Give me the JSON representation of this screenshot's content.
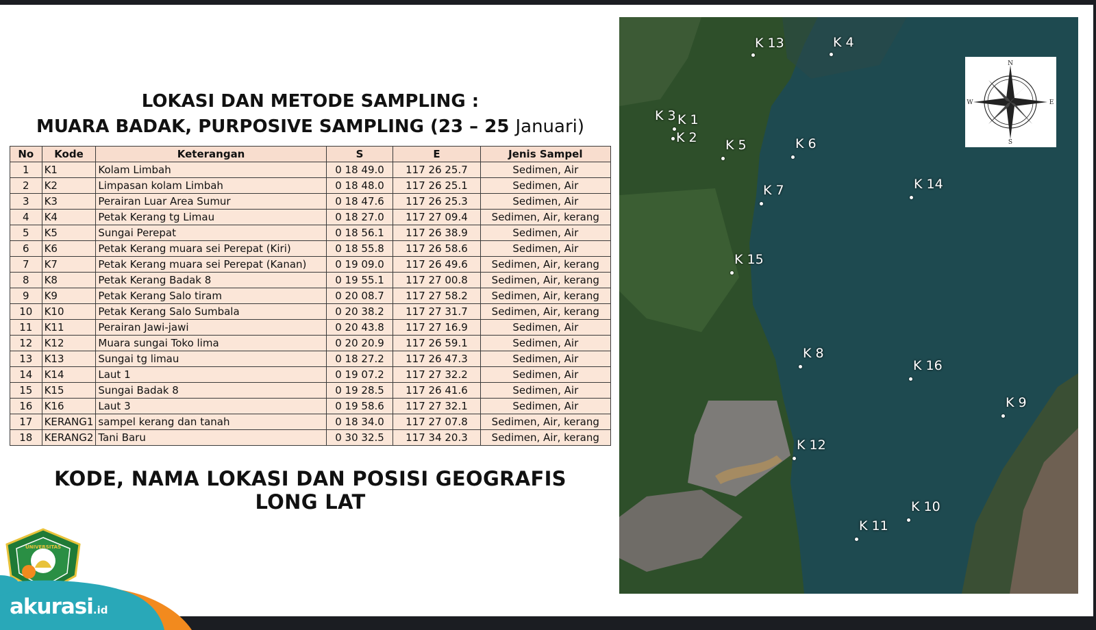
{
  "title": {
    "line1": "LOKASI DAN METODE SAMPLING :",
    "line2_bold": "MUARA BADAK, PURPOSIVE SAMPLING (23 – 25 ",
    "line2_light": "Januari)"
  },
  "table": {
    "headers": [
      "No",
      "Kode",
      "Keterangan",
      "S",
      "E",
      "Jenis Sampel"
    ],
    "rows": [
      [
        "1",
        "K1",
        "Kolam Limbah",
        "0 18 49.0",
        "117 26 25.7",
        "Sedimen, Air"
      ],
      [
        "2",
        "K2",
        "Limpasan kolam Limbah",
        "0 18 48.0",
        "117 26 25.1",
        "Sedimen, Air"
      ],
      [
        "3",
        "K3",
        "Perairan Luar Area Sumur",
        "0 18 47.6",
        "117 26 25.3",
        "Sedimen, Air"
      ],
      [
        "4",
        "K4",
        "Petak Kerang tg Limau",
        "0 18 27.0",
        "117 27 09.4",
        "Sedimen, Air, kerang"
      ],
      [
        "5",
        "K5",
        "Sungai Perepat",
        "0 18 56.1",
        "117 26 38.9",
        "Sedimen, Air"
      ],
      [
        "6",
        "K6",
        "Petak Kerang muara sei Perepat (Kiri)",
        "0 18 55.8",
        "117 26 58.6",
        "Sedimen, Air"
      ],
      [
        "7",
        "K7",
        "Petak Kerang muara sei Perepat (Kanan)",
        "0 19 09.0",
        "117 26 49.6",
        "Sedimen, Air, kerang"
      ],
      [
        "8",
        "K8",
        "Petak Kerang Badak 8",
        "0 19 55.1",
        "117 27 00.8",
        "Sedimen, Air, kerang"
      ],
      [
        "9",
        "K9",
        "Petak Kerang Salo tiram",
        "0 20 08.7",
        "117 27 58.2",
        "Sedimen, Air, kerang"
      ],
      [
        "10",
        "K10",
        "Petak Kerang Salo Sumbala",
        "0 20 38.2",
        "117 27 31.7",
        "Sedimen, Air, kerang"
      ],
      [
        "11",
        "K11",
        "Perairan Jawi-jawi",
        "0 20 43.8",
        "117 27 16.9",
        "Sedimen, Air"
      ],
      [
        "12",
        "K12",
        "Muara sungai Toko lima",
        "0 20 20.9",
        "117 26 59.1",
        "Sedimen, Air"
      ],
      [
        "13",
        "K13",
        "Sungai tg limau",
        "0 18 27.2",
        "117 26 47.3",
        "Sedimen, Air"
      ],
      [
        "14",
        "K14",
        "Laut 1",
        "0 19 07.2",
        "117 27 32.2",
        "Sedimen, Air"
      ],
      [
        "15",
        "K15",
        "Sungai Badak 8",
        "0 19 28.5",
        "117 26 41.6",
        "Sedimen, Air"
      ],
      [
        "16",
        "K16",
        "Laut 3",
        "0 19 58.6",
        "117 27 32.1",
        "Sedimen, Air"
      ],
      [
        "17",
        "KERANG1",
        "sampel kerang dan tanah",
        "0 18 34.0",
        "117 27 07.8",
        "Sedimen, Air, kerang"
      ],
      [
        "18",
        "KERANG2",
        "Tani Baru",
        "0 30 32.5",
        "117 34 20.3",
        "Sedimen, Air, kerang"
      ]
    ]
  },
  "caption": "KODE, NAMA LOKASI DAN POSISI GEOGRAFIS LONG LAT",
  "map": {
    "markers": [
      "K 13",
      "K 4",
      "K 3",
      "K 1",
      "K 2",
      "K 5",
      "K 6",
      "K 7",
      "K 14",
      "K 15",
      "K 8",
      "K 16",
      "K 9",
      "K 12",
      "K 10",
      "K 11"
    ],
    "compass": {
      "n": "N",
      "e": "E",
      "s": "S",
      "w": "W"
    }
  },
  "logo": {
    "text": "UNIVERSITAS",
    "icon": "university-crest-icon"
  },
  "brand": {
    "name": "akurasi",
    "suffix": ".id"
  },
  "colors": {
    "table_header": "#f8ddce",
    "table_row": "#fbe6d8",
    "sea": "#1e4a50",
    "land": "#2e4f2a",
    "brand_teal": "#29a8b8",
    "brand_orange": "#f28a1e"
  }
}
